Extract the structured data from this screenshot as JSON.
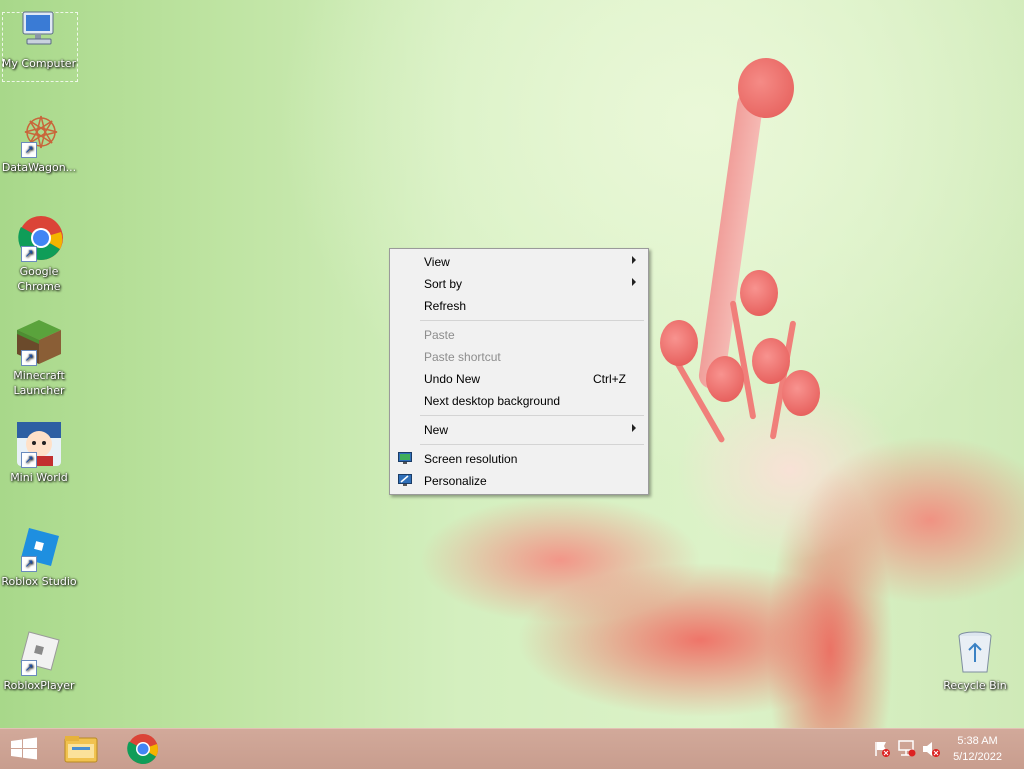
{
  "desktop": {
    "icons": [
      {
        "label": "My Computer"
      },
      {
        "label": "DataWagon..."
      },
      {
        "label": "Google Chrome"
      },
      {
        "label": "Minecraft Launcher"
      },
      {
        "label": "Mini World"
      },
      {
        "label": "Roblox Studio"
      },
      {
        "label": "RobloxPlayer"
      },
      {
        "label": "Recycle Bin"
      }
    ]
  },
  "context_menu": {
    "items": [
      {
        "label": "View",
        "submenu": true,
        "disabled": false,
        "shortcut": ""
      },
      {
        "label": "Sort by",
        "submenu": true,
        "disabled": false,
        "shortcut": ""
      },
      {
        "label": "Refresh",
        "submenu": false,
        "disabled": false,
        "shortcut": ""
      },
      {
        "label": "Paste",
        "submenu": false,
        "disabled": true,
        "shortcut": ""
      },
      {
        "label": "Paste shortcut",
        "submenu": false,
        "disabled": true,
        "shortcut": ""
      },
      {
        "label": "Undo New",
        "submenu": false,
        "disabled": false,
        "shortcut": "Ctrl+Z"
      },
      {
        "label": "Next desktop background",
        "submenu": false,
        "disabled": false,
        "shortcut": ""
      },
      {
        "label": "New",
        "submenu": true,
        "disabled": false,
        "shortcut": ""
      },
      {
        "label": "Screen resolution",
        "submenu": false,
        "disabled": false,
        "shortcut": "",
        "icon": "display-icon"
      },
      {
        "label": "Personalize",
        "submenu": false,
        "disabled": false,
        "shortcut": "",
        "icon": "personalize-icon"
      }
    ]
  },
  "taskbar": {
    "pinned": [
      {
        "icon": "windows-start-icon"
      },
      {
        "icon": "file-explorer-icon"
      },
      {
        "icon": "chrome-icon"
      }
    ],
    "tray_icons": [
      "action-center-flag-icon",
      "network-icon",
      "volume-muted-icon"
    ],
    "clock": {
      "time": "5:38 AM",
      "date": "5/12/2022"
    }
  },
  "colors": {
    "taskbar": "#c89d8e",
    "menu_bg": "#f1f1f1",
    "disabled_text": "#8d8d8d"
  }
}
